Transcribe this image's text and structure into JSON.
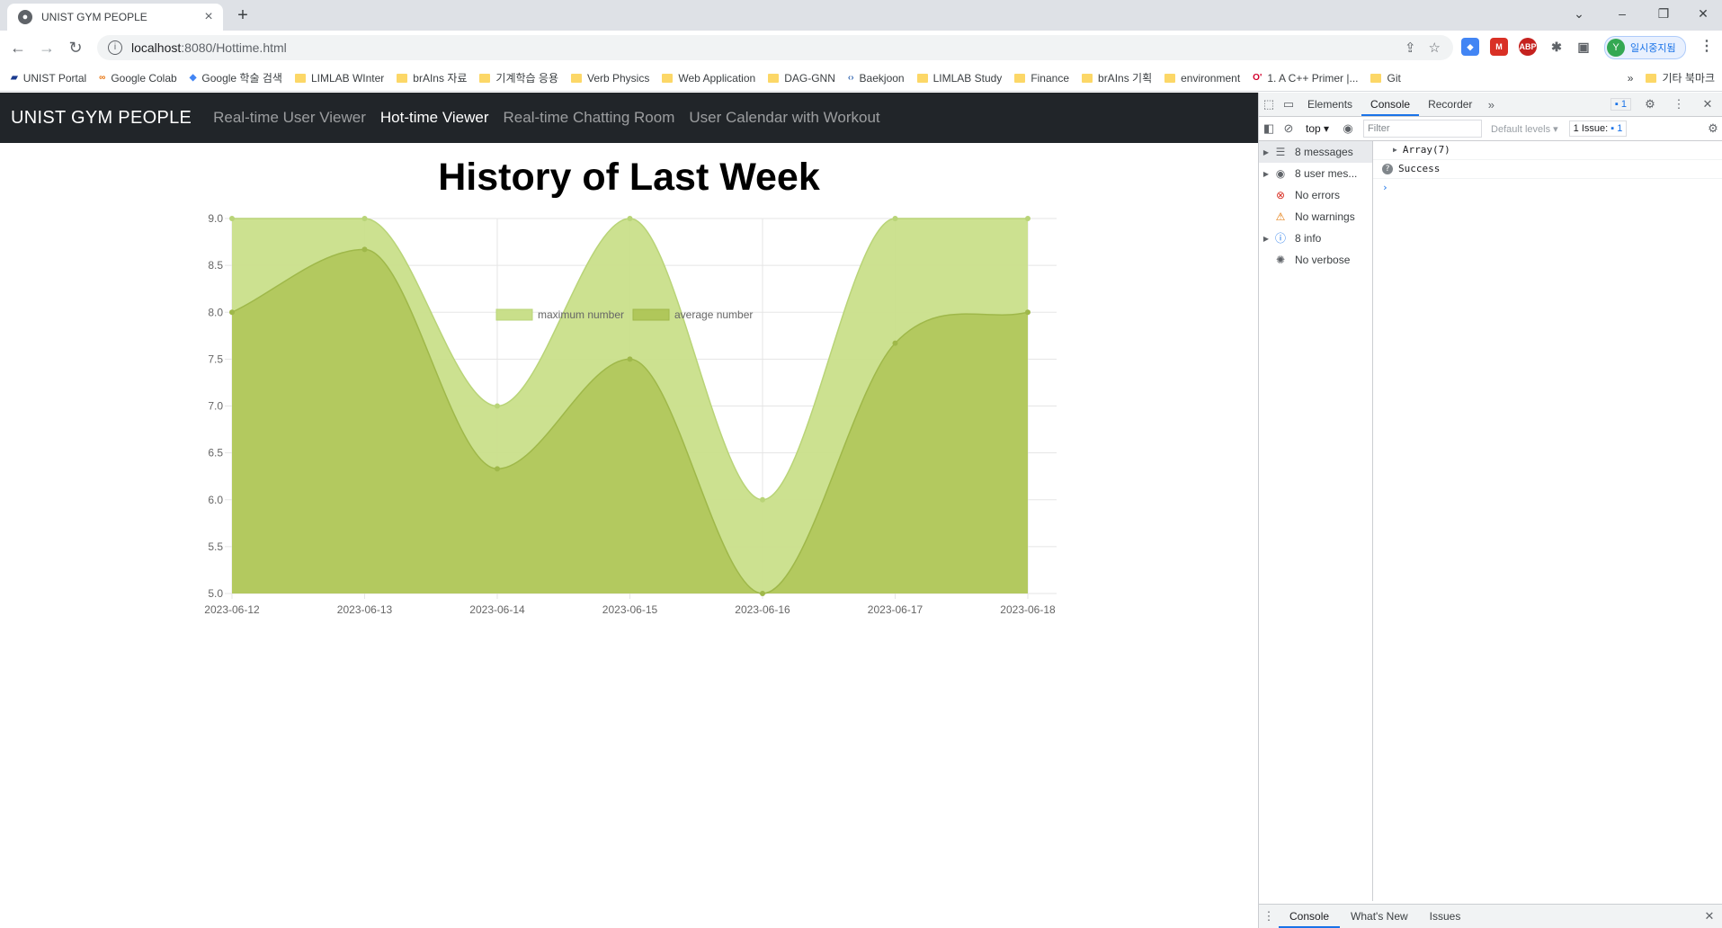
{
  "browser": {
    "tab_title": "UNIST GYM PEOPLE",
    "url_host": "localhost",
    "url_rest": ":8080/Hottime.html",
    "profile_initial": "Y",
    "profile_label": "일시중지됨",
    "bookmarks": [
      {
        "label": "UNIST Portal",
        "icon": "unist-icon"
      },
      {
        "label": "Google Colab",
        "icon": "colab-icon"
      },
      {
        "label": "Google 학술 검색",
        "icon": "scholar-icon"
      },
      {
        "label": "LIMLAB WInter",
        "icon": "folder-icon"
      },
      {
        "label": "brAIns 자료",
        "icon": "folder-icon"
      },
      {
        "label": "기계학습 응용",
        "icon": "folder-icon"
      },
      {
        "label": "Verb Physics",
        "icon": "folder-icon"
      },
      {
        "label": "Web Application",
        "icon": "folder-icon"
      },
      {
        "label": "DAG-GNN",
        "icon": "folder-icon"
      },
      {
        "label": "Baekjoon",
        "icon": "code-icon"
      },
      {
        "label": "LIMLAB Study",
        "icon": "folder-icon"
      },
      {
        "label": "Finance",
        "icon": "folder-icon"
      },
      {
        "label": "brAIns 기획",
        "icon": "folder-icon"
      },
      {
        "label": "environment",
        "icon": "folder-icon"
      },
      {
        "label": "1. A C++ Primer |...",
        "icon": "oreilly-icon"
      },
      {
        "label": "Git",
        "icon": "folder-icon"
      }
    ],
    "other_bookmarks": "기타 북마크"
  },
  "navbar": {
    "brand": "UNIST GYM PEOPLE",
    "links": [
      "Real-time User Viewer",
      "Hot-time Viewer",
      "Real-time Chatting Room",
      "User Calendar with Workout"
    ],
    "active_index": 1
  },
  "page": {
    "heading": "History of Last Week"
  },
  "chart_data": {
    "type": "area",
    "x": [
      "2023-06-12",
      "2023-06-13",
      "2023-06-14",
      "2023-06-15",
      "2023-06-16",
      "2023-06-17",
      "2023-06-18"
    ],
    "series": [
      {
        "name": "maximum number",
        "values": [
          9,
          9,
          7,
          9,
          6,
          9,
          9
        ],
        "color": "#c9df8a"
      },
      {
        "name": "average number",
        "values": [
          8,
          8.67,
          6.33,
          7.5,
          5,
          7.67,
          8
        ],
        "color": "#b0c75a"
      }
    ],
    "ylim": [
      5,
      9
    ],
    "yticks": [
      "5.0",
      "5.5",
      "6.0",
      "6.5",
      "7.0",
      "7.5",
      "8.0",
      "8.5",
      "9.0"
    ],
    "legend": "top",
    "grid": true
  },
  "devtools": {
    "tabs": [
      "Elements",
      "Console",
      "Recorder"
    ],
    "active_tab": "Console",
    "msg_badge": "1",
    "context": "top",
    "filter_placeholder": "Filter",
    "levels": "Default levels",
    "issues": "1 Issue:",
    "issues_count": "1",
    "sidebar": [
      {
        "label": "8 messages",
        "icon": "list-icon",
        "expandable": true
      },
      {
        "label": "8 user mes...",
        "icon": "user-icon",
        "expandable": true
      },
      {
        "label": "No errors",
        "icon": "error-icon",
        "expandable": false
      },
      {
        "label": "No warnings",
        "icon": "warning-icon",
        "expandable": false
      },
      {
        "label": "8 info",
        "icon": "info-icon",
        "expandable": true
      },
      {
        "label": "No verbose",
        "icon": "bug-icon",
        "expandable": false
      }
    ],
    "console_lines": [
      "Array(7)",
      "Success"
    ],
    "bottom_tabs": [
      "Console",
      "What's New",
      "Issues"
    ]
  }
}
